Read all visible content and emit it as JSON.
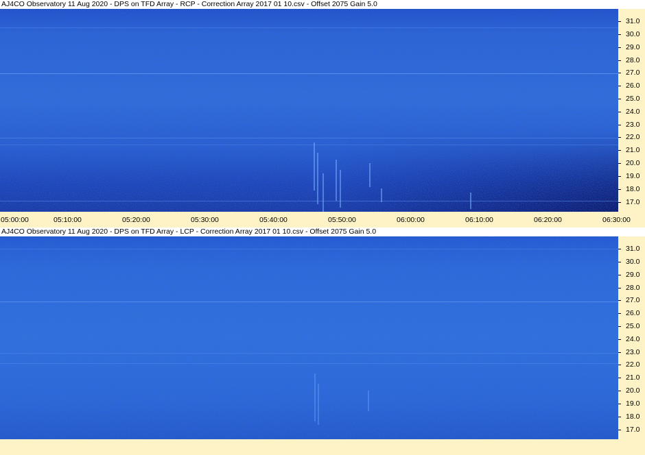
{
  "colors": {
    "background": "#fdf3c6",
    "title_bg": "#ffffff",
    "spectrogram_light": "#2f6fe0",
    "spectrogram_dark": "#0a1a70"
  },
  "panels": [
    {
      "title": "AJ4CO Observatory 11 Aug 2020  -  DPS on TFD Array  -  RCP  -  Correction Array 2017 01 10.csv  -  Offset 2075  Gain 5.0",
      "y_ticks": [
        "31.0",
        "30.0",
        "29.0",
        "28.0",
        "27.0",
        "26.0",
        "25.0",
        "24.0",
        "23.0",
        "22.0",
        "21.0",
        "20.0",
        "19.0",
        "18.0",
        "17.0"
      ]
    },
    {
      "title": "AJ4CO Observatory 11 Aug 2020  -  DPS on TFD Array  -  LCP  -  Correction Array 2017 01 10.csv  -  Offset 2075  Gain 5.0",
      "y_ticks": [
        "31.0",
        "30.0",
        "29.0",
        "28.0",
        "27.0",
        "26.0",
        "25.0",
        "24.0",
        "23.0",
        "22.0",
        "21.0",
        "20.0",
        "19.0",
        "18.0",
        "17.0"
      ]
    }
  ],
  "time_axis": {
    "labels": [
      "05:00:00",
      "05:10:00",
      "05:20:00",
      "05:30:00",
      "05:40:00",
      "05:50:00",
      "06:00:00",
      "06:10:00",
      "06:20:00",
      "06:30:00"
    ]
  }
}
